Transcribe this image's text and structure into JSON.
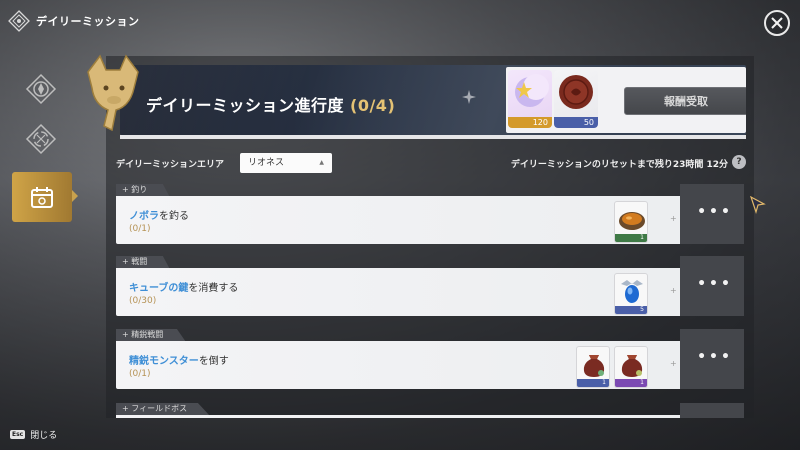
{
  "app": {
    "title": "デイリーミッション",
    "close_icon": "close-icon"
  },
  "colors": {
    "accent_gold": "#d6a846",
    "highlight_blue": "#3f8fd6",
    "progress_gold": "#e4c274"
  },
  "side_nav": {
    "items": [
      {
        "icon": "compass-emblem-icon",
        "active": false
      },
      {
        "icon": "cycle-emblem-icon",
        "active": false
      },
      {
        "icon": "mission-calendar-icon",
        "active": true
      }
    ]
  },
  "header": {
    "title": "デイリーミッション進行度",
    "progress": "(0/4)",
    "rewards": [
      {
        "icon": "moon-star-currency-icon",
        "count": "120"
      },
      {
        "icon": "wax-seal-icon",
        "count": "50"
      }
    ],
    "claim_label": "報酬受取"
  },
  "area": {
    "label": "デイリーミッションエリア",
    "selected": "リオネス",
    "reset_text": "デイリーミッションのリセットまで残り23時間 12分",
    "help": "?"
  },
  "missions": [
    {
      "category": "釣り",
      "name_hl": "ノボラ",
      "name_rest": "を釣る",
      "progress": "(0/1)",
      "rewards": [
        {
          "icon": "food-dish-icon",
          "count": "1",
          "bar": "#3f7a46"
        }
      ]
    },
    {
      "category": "戦闘",
      "name_hl": "キューブの鍵",
      "name_rest": "を消費する",
      "progress": "(0/30)",
      "rewards": [
        {
          "icon": "blue-crystal-icon",
          "count": "5",
          "bar": "#4a5fa8"
        }
      ]
    },
    {
      "category": "精鋭戦闘",
      "name_hl": "精鋭モンスター",
      "name_rest": "を倒す",
      "progress": "(0/1)",
      "rewards": [
        {
          "icon": "loot-bag-icon",
          "count": "1",
          "bar": "#4a5fa8"
        },
        {
          "icon": "loot-bag-icon",
          "count": "1",
          "bar": "#7b4ab2"
        }
      ]
    },
    {
      "category": "フィールドボス",
      "name_hl": "",
      "name_rest": "",
      "progress": "",
      "rewards": []
    }
  ],
  "footer": {
    "esc_key": "Esc",
    "close_label": "閉じる"
  }
}
